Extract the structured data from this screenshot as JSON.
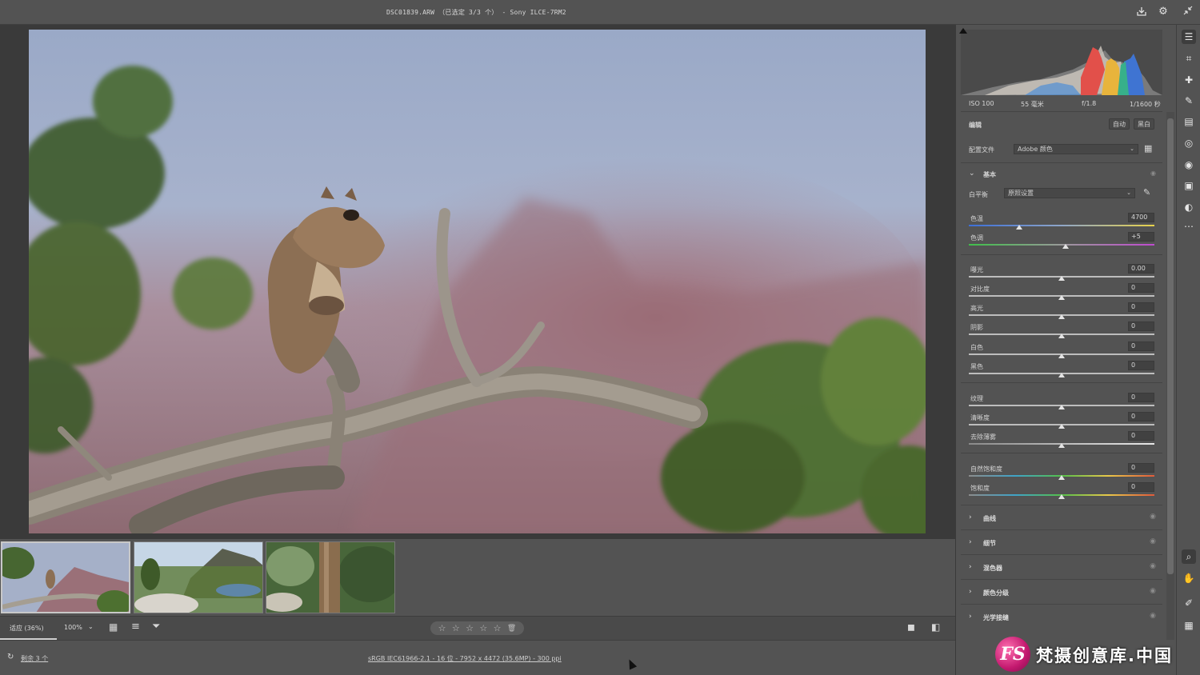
{
  "titlebar": {
    "title": "DSC01839.ARW （已选定 3/3 个） - Sony ILCE-7RM2",
    "icons": [
      "save-export-icon",
      "settings-gear-icon",
      "collapse-icon"
    ]
  },
  "filmstrip": {
    "thumbnails": [
      {
        "name": "squirrel-on-branch",
        "selected": true
      },
      {
        "name": "mountain-meadow-pond",
        "selected": false
      },
      {
        "name": "forest-tree-trunk",
        "selected": false
      }
    ]
  },
  "bottombar": {
    "fit_label": "适应 (36%)",
    "zoom_label": "100%",
    "rating_stars": 5,
    "icons": [
      "filmstrip-view-icon",
      "sort-icon",
      "filter-icon",
      "trash-icon",
      "single-view-icon",
      "compare-view-icon"
    ]
  },
  "status": {
    "remaining": "剩余 3 个",
    "file_info": "sRGB IEC61966-2.1 - 16 位 - 7952 x 4472 (35.6MP) - 300 ppi"
  },
  "exif": {
    "iso": "ISO 100",
    "focal": "55 毫米",
    "aperture": "f/1.8",
    "shutter": "1/1600 秒"
  },
  "edit": {
    "header": "编辑",
    "auto_label": "自动",
    "bw_label": "黑白",
    "profile_label": "配置文件",
    "profile_value": "Adobe 颜色"
  },
  "basic": {
    "title": "基本",
    "wb_label": "白平衡",
    "wb_value": "原照设置",
    "sliders": {
      "temp": {
        "label": "色温",
        "value": "4700"
      },
      "tint": {
        "label": "色调",
        "value": "+5"
      },
      "exposure": {
        "label": "曝光",
        "value": "0.00"
      },
      "contrast": {
        "label": "对比度",
        "value": "0"
      },
      "highlights": {
        "label": "高光",
        "value": "0"
      },
      "shadows": {
        "label": "阴影",
        "value": "0"
      },
      "whites": {
        "label": "白色",
        "value": "0"
      },
      "blacks": {
        "label": "黑色",
        "value": "0"
      },
      "texture": {
        "label": "纹理",
        "value": "0"
      },
      "clarity": {
        "label": "清晰度",
        "value": "0"
      },
      "dehaze": {
        "label": "去除薄雾",
        "value": "0"
      },
      "vibrance": {
        "label": "自然饱和度",
        "value": "0"
      },
      "saturation": {
        "label": "饱和度",
        "value": "0"
      }
    }
  },
  "sections": [
    "曲线",
    "细节",
    "混色器",
    "颜色分级",
    "光学接缝"
  ],
  "tools": [
    "edit-sliders-icon",
    "crop-icon",
    "healing-icon",
    "brush-icon",
    "gradient-icon",
    "radial-icon",
    "redeye-icon",
    "snapshot-icon",
    "presets-icon",
    "more-icon",
    "zoom-icon",
    "hand-icon",
    "eyedropper-icon",
    "grid-icon"
  ],
  "watermark": {
    "logo": "FS",
    "text": "梵摄创意库.中国"
  },
  "colors": {
    "panel_bg": "#535353",
    "canvas_bg": "#3a3a3a",
    "temp_gradient": [
      "#4a6fd0",
      "#e8d24a"
    ],
    "tint_gradient": [
      "#3fbf4a",
      "#c04ad0"
    ]
  }
}
